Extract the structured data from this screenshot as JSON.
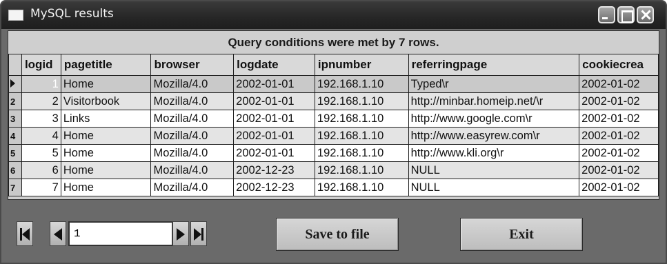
{
  "window": {
    "title": "MySQL results"
  },
  "grid": {
    "banner": "Query conditions were met by 7 rows.",
    "columns": [
      "logid",
      "pagetitle",
      "browser",
      "logdate",
      "ipnumber",
      "referringpage",
      "cookiecrea"
    ],
    "rows": [
      {
        "indicator": "",
        "logid": "1",
        "pagetitle": "Home",
        "browser": "Mozilla/4.0",
        "logdate": "2002-01-01",
        "ipnumber": "192.168.1.10",
        "referringpage": "Typed\\r",
        "cookiecrea": "2002-01-02"
      },
      {
        "indicator": "2",
        "logid": "2",
        "pagetitle": "Visitorbook",
        "browser": "Mozilla/4.0",
        "logdate": "2002-01-01",
        "ipnumber": "192.168.1.10",
        "referringpage": "http://minbar.homeip.net/\\r",
        "cookiecrea": "2002-01-02"
      },
      {
        "indicator": "3",
        "logid": "3",
        "pagetitle": "Links",
        "browser": "Mozilla/4.0",
        "logdate": "2002-01-01",
        "ipnumber": "192.168.1.10",
        "referringpage": "http://www.google.com\\r",
        "cookiecrea": "2002-01-02"
      },
      {
        "indicator": "4",
        "logid": "4",
        "pagetitle": "Home",
        "browser": "Mozilla/4.0",
        "logdate": "2002-01-01",
        "ipnumber": "192.168.1.10",
        "referringpage": "http://www.easyrew.com\\r",
        "cookiecrea": "2002-01-02"
      },
      {
        "indicator": "5",
        "logid": "5",
        "pagetitle": "Home",
        "browser": "Mozilla/4.0",
        "logdate": "2002-01-01",
        "ipnumber": "192.168.1.10",
        "referringpage": "http://www.kli.org\\r",
        "cookiecrea": "2002-01-02"
      },
      {
        "indicator": "6",
        "logid": "6",
        "pagetitle": "Home",
        "browser": "Mozilla/4.0",
        "logdate": "2002-12-23",
        "ipnumber": "192.168.1.10",
        "referringpage": "NULL",
        "cookiecrea": "2002-01-02"
      },
      {
        "indicator": "7",
        "logid": "7",
        "pagetitle": "Home",
        "browser": "Mozilla/4.0",
        "logdate": "2002-12-23",
        "ipnumber": "192.168.1.10",
        "referringpage": "NULL",
        "cookiecrea": "2002-01-02"
      }
    ],
    "current_row_index": 0
  },
  "navigator": {
    "page_value": "1",
    "first_icon": "first-record-icon",
    "prev_icon": "previous-record-icon",
    "next_icon": "next-record-icon",
    "last_icon": "last-record-icon"
  },
  "buttons": {
    "save_label": "Save to file",
    "exit_label": "Exit"
  },
  "colors": {
    "titlebar": "#262626",
    "window_body": "#6a6a6a",
    "grid_alt_row": "#e4e4e4",
    "grid_row": "#ffffff"
  }
}
